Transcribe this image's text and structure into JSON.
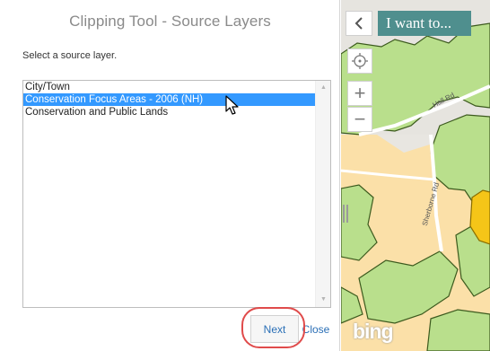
{
  "panel": {
    "title": "Clipping Tool - Source Layers",
    "prompt": "Select a source layer."
  },
  "layers": {
    "items": [
      {
        "label": "City/Town",
        "selected": false
      },
      {
        "label": "Conservation Focus Areas - 2006 (NH)",
        "selected": true
      },
      {
        "label": "Conservation and Public Lands",
        "selected": false
      }
    ]
  },
  "buttons": {
    "next": "Next",
    "close": "Close"
  },
  "map": {
    "i_want_to": "I want to...",
    "collapse_icon": "chevron-left-icon",
    "locate_icon": "crosshair-icon",
    "zoom_in": "+",
    "zoom_out": "−",
    "roads": {
      "hall": "Hall Rd",
      "sherborne": "Sherborne Rd"
    },
    "provider_logo": "bing",
    "colors": {
      "accent": "#4f8f8e",
      "conservation_green": "#b9df8c",
      "public_land_tan": "#fbe0a8",
      "highlight_yellow": "#f5c518",
      "selection_blue": "#3399ff"
    }
  }
}
